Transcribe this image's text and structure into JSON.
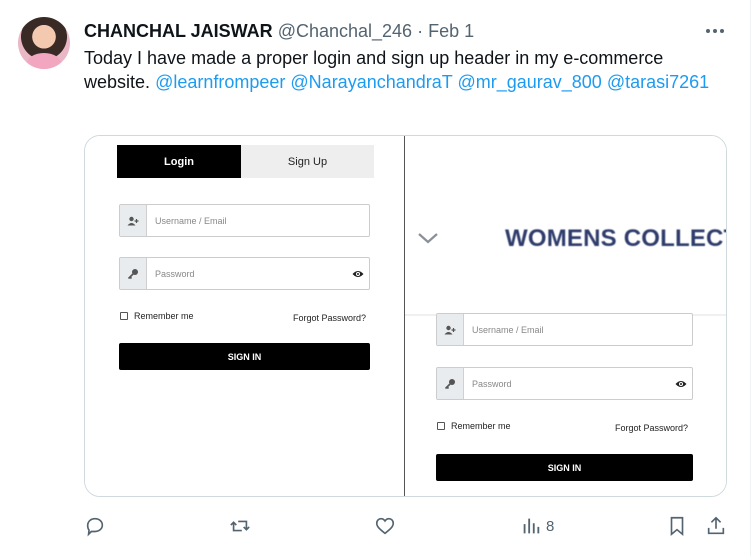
{
  "tweet": {
    "author_name": "CHANCHAL JAISWAR",
    "handle": "@Chanchal_246",
    "separator": "·",
    "date": "Feb 1",
    "text_plain": "Today I have made a proper login and sign up header in my e-commerce website.",
    "mentions": [
      "@learnfrompeer",
      "@NarayanchandraT",
      "@mr_gaurav_800",
      "@tarasi7261"
    ]
  },
  "left_form": {
    "tab_login": "Login",
    "tab_signup": "Sign Up",
    "username_placeholder": "Username / Email",
    "password_placeholder": "Password",
    "remember_label": "Remember me",
    "forgot_label": "Forgot Password?",
    "signin_label": "SIGN IN"
  },
  "right_form": {
    "banner_title": "WOMENS COLLECT",
    "username_placeholder": "Username / Email",
    "password_placeholder": "Password",
    "remember_label": "Remember me",
    "forgot_label": "Forgot Password?",
    "signin_label": "SIGN IN"
  },
  "actions": {
    "views_count": "8"
  },
  "colors": {
    "mention": "#1d9bf0",
    "muted": "#536471",
    "banner_title": "#2f3c6b"
  },
  "icons": [
    "more-icon",
    "user-icon",
    "key-icon",
    "eye-icon",
    "chevron-down-icon",
    "reply-icon",
    "retweet-icon",
    "like-icon",
    "views-icon",
    "bookmark-icon",
    "share-icon"
  ]
}
